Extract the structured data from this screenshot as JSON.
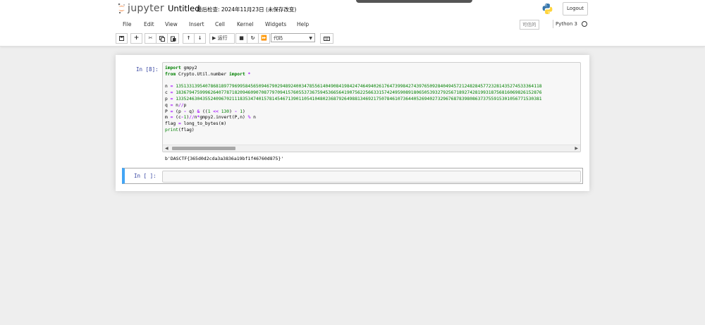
{
  "header": {
    "logo_text": "jupyter",
    "title": "Untitled",
    "checkpoint": "最后检查: 2024年11月23日  (未保存改变)",
    "logout_label": "Logout"
  },
  "menu": {
    "items": [
      "File",
      "Edit",
      "View",
      "Insert",
      "Cell",
      "Kernel",
      "Widgets",
      "Help"
    ],
    "trusted_label": "可信的",
    "kernel_name": "Python 3"
  },
  "toolbar": {
    "run_label": "运行",
    "cell_type": "代码"
  },
  "cells": [
    {
      "prompt": "In  [8]:",
      "code_lines": [
        "import gmpy2",
        "from Crypto.Util.number import *",
        "",
        "n = 13513313954078681897796995845650946790294892400347855614049084198424746494026176473998427439765092840494572124828457723281435274533364118",
        "c = 18367947599962640778718209460907087797094157605537367594536656419075622566331574249590891806505393279256718927428199318756816069826152876",
        "p = 13352463043552409670211183534740157814546713901105410480236879264988134692175078461073644052694027329676878398086373755915301056771530381",
        "q = n//p",
        "P = (p - q) & ((1 << 130) - 1)",
        "m = (c-1)//n*gmpy2.invert(P,n) % n",
        "flag = long_to_bytes(m)",
        "print(flag)"
      ],
      "output": "b'DASCTF{365d0d2cda3a3836a19bf1f46760d875}'"
    },
    {
      "prompt": "In  [  ]:",
      "code_lines": []
    }
  ],
  "colors": {
    "keyword": "#008000",
    "operator": "#aa22ff",
    "prompt": "#303f9f",
    "selected_cell": "#42a5f5"
  }
}
